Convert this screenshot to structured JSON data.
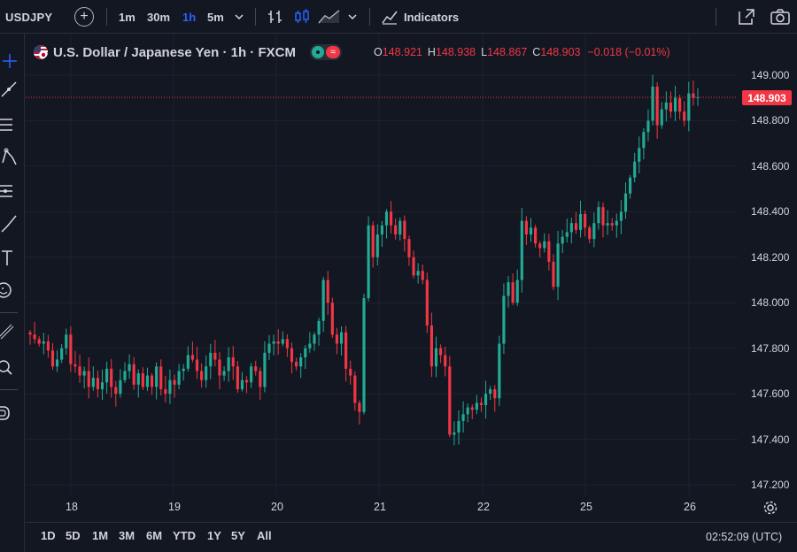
{
  "toolbar": {
    "symbol": "USDJPY",
    "timeframes": [
      "1m",
      "30m",
      "1h",
      "5m"
    ],
    "active_timeframe": "1h",
    "indicators_label": "Indicators"
  },
  "legend": {
    "title": "U.S. Dollar / Japanese Yen · 1h · FXCM",
    "ohlc": [
      {
        "k": "O",
        "v": "148.921"
      },
      {
        "k": "H",
        "v": "148.938"
      },
      {
        "k": "L",
        "v": "148.867"
      },
      {
        "k": "C",
        "v": "148.903"
      },
      {
        "k": "",
        "v": "−0.018 (−0.01%)"
      }
    ]
  },
  "colors": {
    "up": "#22ab94",
    "down": "#f23645",
    "bg": "#131722",
    "grid": "#1e222d",
    "text": "#d1d4dc",
    "accent": "#2962ff"
  },
  "price_axis": {
    "labels": [
      "149.000",
      "148.800",
      "148.600",
      "148.400",
      "148.200",
      "148.000",
      "147.800",
      "147.600",
      "147.400",
      "147.200"
    ],
    "last_price": "148.903"
  },
  "time_axis": [
    "18",
    "19",
    "20",
    "21",
    "22",
    "25",
    "26"
  ],
  "ranges": [
    "1D",
    "5D",
    "1M",
    "3M",
    "6M",
    "YTD",
    "1Y",
    "5Y",
    "All"
  ],
  "clock": "02:52:09 (UTC)",
  "chart_data": {
    "type": "candlestick",
    "symbol": "USDJPY",
    "interval": "1h",
    "ylim": [
      147.2,
      149.0
    ],
    "last": 148.903,
    "days": [
      "18",
      "19",
      "20",
      "21",
      "22",
      "25",
      "26"
    ],
    "closes": [
      147.86,
      147.84,
      147.82,
      147.83,
      147.79,
      147.72,
      147.75,
      147.8,
      147.86,
      147.73,
      147.72,
      147.68,
      147.7,
      147.63,
      147.67,
      147.62,
      147.65,
      147.71,
      147.63,
      147.6,
      147.66,
      147.7,
      147.73,
      147.64,
      147.69,
      147.63,
      147.68,
      147.63,
      147.72,
      147.62,
      147.6,
      147.66,
      147.64,
      147.7,
      147.71,
      147.77,
      147.75,
      147.7,
      147.66,
      147.72,
      147.78,
      147.75,
      147.68,
      147.7,
      147.76,
      147.72,
      147.62,
      147.66,
      147.65,
      147.72,
      147.7,
      147.63,
      147.78,
      147.82,
      147.83,
      147.82,
      147.84,
      147.8,
      147.74,
      147.72,
      147.76,
      147.8,
      147.82,
      147.86,
      147.92,
      148.1,
      148.0,
      147.86,
      147.82,
      147.87,
      147.71,
      147.68,
      147.56,
      147.52,
      148.02,
      148.34,
      148.2,
      148.3,
      148.34,
      148.4,
      148.34,
      148.3,
      148.36,
      148.28,
      148.2,
      148.12,
      148.14,
      148.1,
      147.9,
      147.72,
      147.8,
      147.77,
      147.72,
      147.42,
      147.43,
      147.48,
      147.51,
      147.54,
      147.53,
      147.56,
      147.55,
      147.6,
      147.62,
      147.58,
      147.82,
      148.03,
      148.09,
      148.0,
      148.1,
      148.36,
      148.3,
      148.33,
      148.26,
      148.24,
      148.27,
      148.18,
      148.07,
      148.26,
      148.29,
      148.31,
      148.35,
      148.32,
      148.39,
      148.33,
      148.28,
      148.35,
      148.42,
      148.34,
      148.35,
      148.34,
      148.36,
      148.4,
      148.48,
      148.55,
      148.62,
      148.68,
      148.75,
      148.8,
      148.95,
      148.78,
      148.85,
      148.88,
      148.84,
      148.9,
      148.84,
      148.8,
      148.92,
      148.9,
      148.903
    ]
  }
}
